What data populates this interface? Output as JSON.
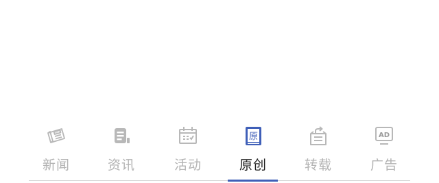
{
  "colors": {
    "active_text": "#1f1f1f",
    "inactive_text": "#b3b3b3",
    "inactive_icon": "#b8b8b8",
    "accent": "#3f5fb8",
    "divider": "#d5d5d5"
  },
  "tabs": [
    {
      "label": "新闻",
      "icon": "newspaper-icon",
      "active": false,
      "icon_text": "NEWS"
    },
    {
      "label": "资讯",
      "icon": "document-icon",
      "active": false
    },
    {
      "label": "活动",
      "icon": "calendar-icon",
      "active": false
    },
    {
      "label": "原创",
      "icon": "book-icon",
      "active": true,
      "icon_text": "原"
    },
    {
      "label": "转载",
      "icon": "share-icon",
      "active": false
    },
    {
      "label": "广告",
      "icon": "ad-icon",
      "active": false,
      "icon_text": "AD"
    }
  ]
}
